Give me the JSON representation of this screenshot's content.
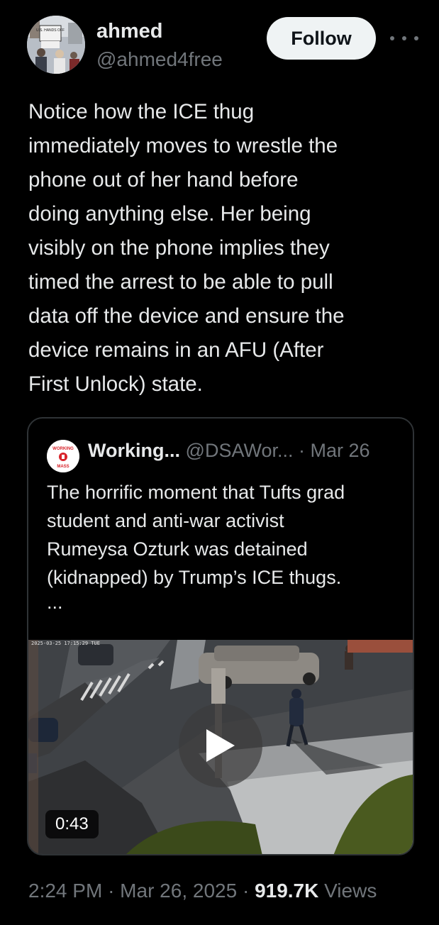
{
  "author": {
    "name": "ahmed",
    "handle": "@ahmed4free",
    "avatar_icon": "protest-photo-avatar",
    "avatar_sign_text": "U.S. HANDS OFF"
  },
  "follow_label": "Follow",
  "more_icon": "more-horizontal-icon",
  "tweet_text": "Notice how the ICE thug\nimmediately moves to wrestle the\nphone out of her hand before\ndoing anything else. Her being\nvisibly on the phone implies they\ntimed the arrest to be able to pull\ndata off the device and ensure the\ndevice remains in an AFU (After\nFirst Unlock) state.",
  "quote": {
    "avatar_icon": "working-mass-logo",
    "avatar_top_text": "WORKING",
    "avatar_bottom_text": "MASS",
    "name": "Working...",
    "handle": "@DSAWor...",
    "separator": "·",
    "date": "Mar 26",
    "text": "The horrific moment that Tufts grad\nstudent and anti-war activist\nRumeysa Ozturk was detained\n(kidnapped) by Trump’s ICE thugs.",
    "ellipsis": "...",
    "video": {
      "timestamp": "2025-03-25 17:15:29 TUE",
      "duration": "0:43",
      "play_icon": "play-icon"
    }
  },
  "footer": {
    "time": "2:24 PM",
    "sep1": "·",
    "date": "Mar 26, 2025",
    "sep2": "·",
    "views_count": "919.7K",
    "views_label": "Views"
  },
  "colors": {
    "background": "#000000",
    "text": "#e7e9ea",
    "secondary": "#71767b",
    "border": "#2f3336",
    "follow_bg": "#eff3f4"
  }
}
